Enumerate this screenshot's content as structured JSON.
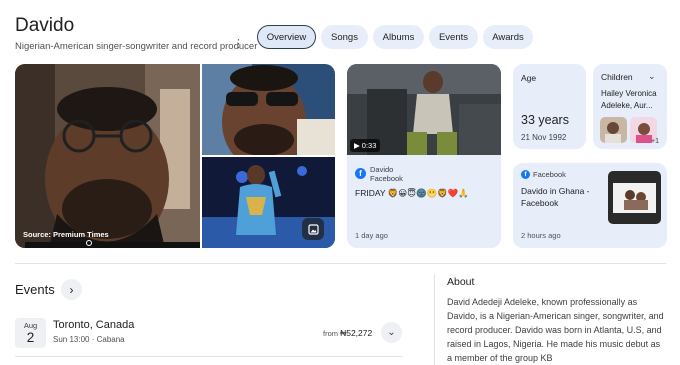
{
  "header": {
    "title": "Davido",
    "subtitle": "Nigerian-American singer-songwriter and record producer"
  },
  "tabs": [
    {
      "label": "Overview",
      "active": true
    },
    {
      "label": "Songs",
      "active": false
    },
    {
      "label": "Albums",
      "active": false
    },
    {
      "label": "Events",
      "active": false
    },
    {
      "label": "Awards",
      "active": false
    }
  ],
  "gallery": {
    "source_label": "Source: Premium Times"
  },
  "video_card": {
    "duration": "0:33",
    "source_name": "Davido",
    "platform": "Facebook",
    "text": "FRIDAY 🦁😀😇🌚😬🦁❤️🙏",
    "time": "1 day ago"
  },
  "age_card": {
    "label": "Age",
    "value": "33 years",
    "birth_date": "21 Nov 1992"
  },
  "children_card": {
    "label": "Children",
    "names": "Hailey Veronica Adeleke, Aur...",
    "more": "+1"
  },
  "post_card": {
    "platform": "Facebook",
    "title": "Davido in Ghana - Facebook",
    "time": "2 hours ago"
  },
  "events": {
    "title": "Events",
    "items": [
      {
        "month": "Aug",
        "day": "2",
        "location": "Toronto, Canada",
        "meta": "Sun 13:00 · Cabana",
        "price_prefix": "from",
        "price": "₦52,272"
      }
    ]
  },
  "about": {
    "title": "About",
    "text": "David Adedeji Adeleke, known professionally as Davido, is a Nigerian-American singer, songwriter, and record producer. Davido was born in Atlanta, U.S, and raised in Lagos, Nigeria. He made his music debut as a member of the group KB"
  },
  "colors": {
    "card_bg": "#e8eef9",
    "facebook": "#1877f2",
    "active_tab_border": "#2f3d52"
  }
}
